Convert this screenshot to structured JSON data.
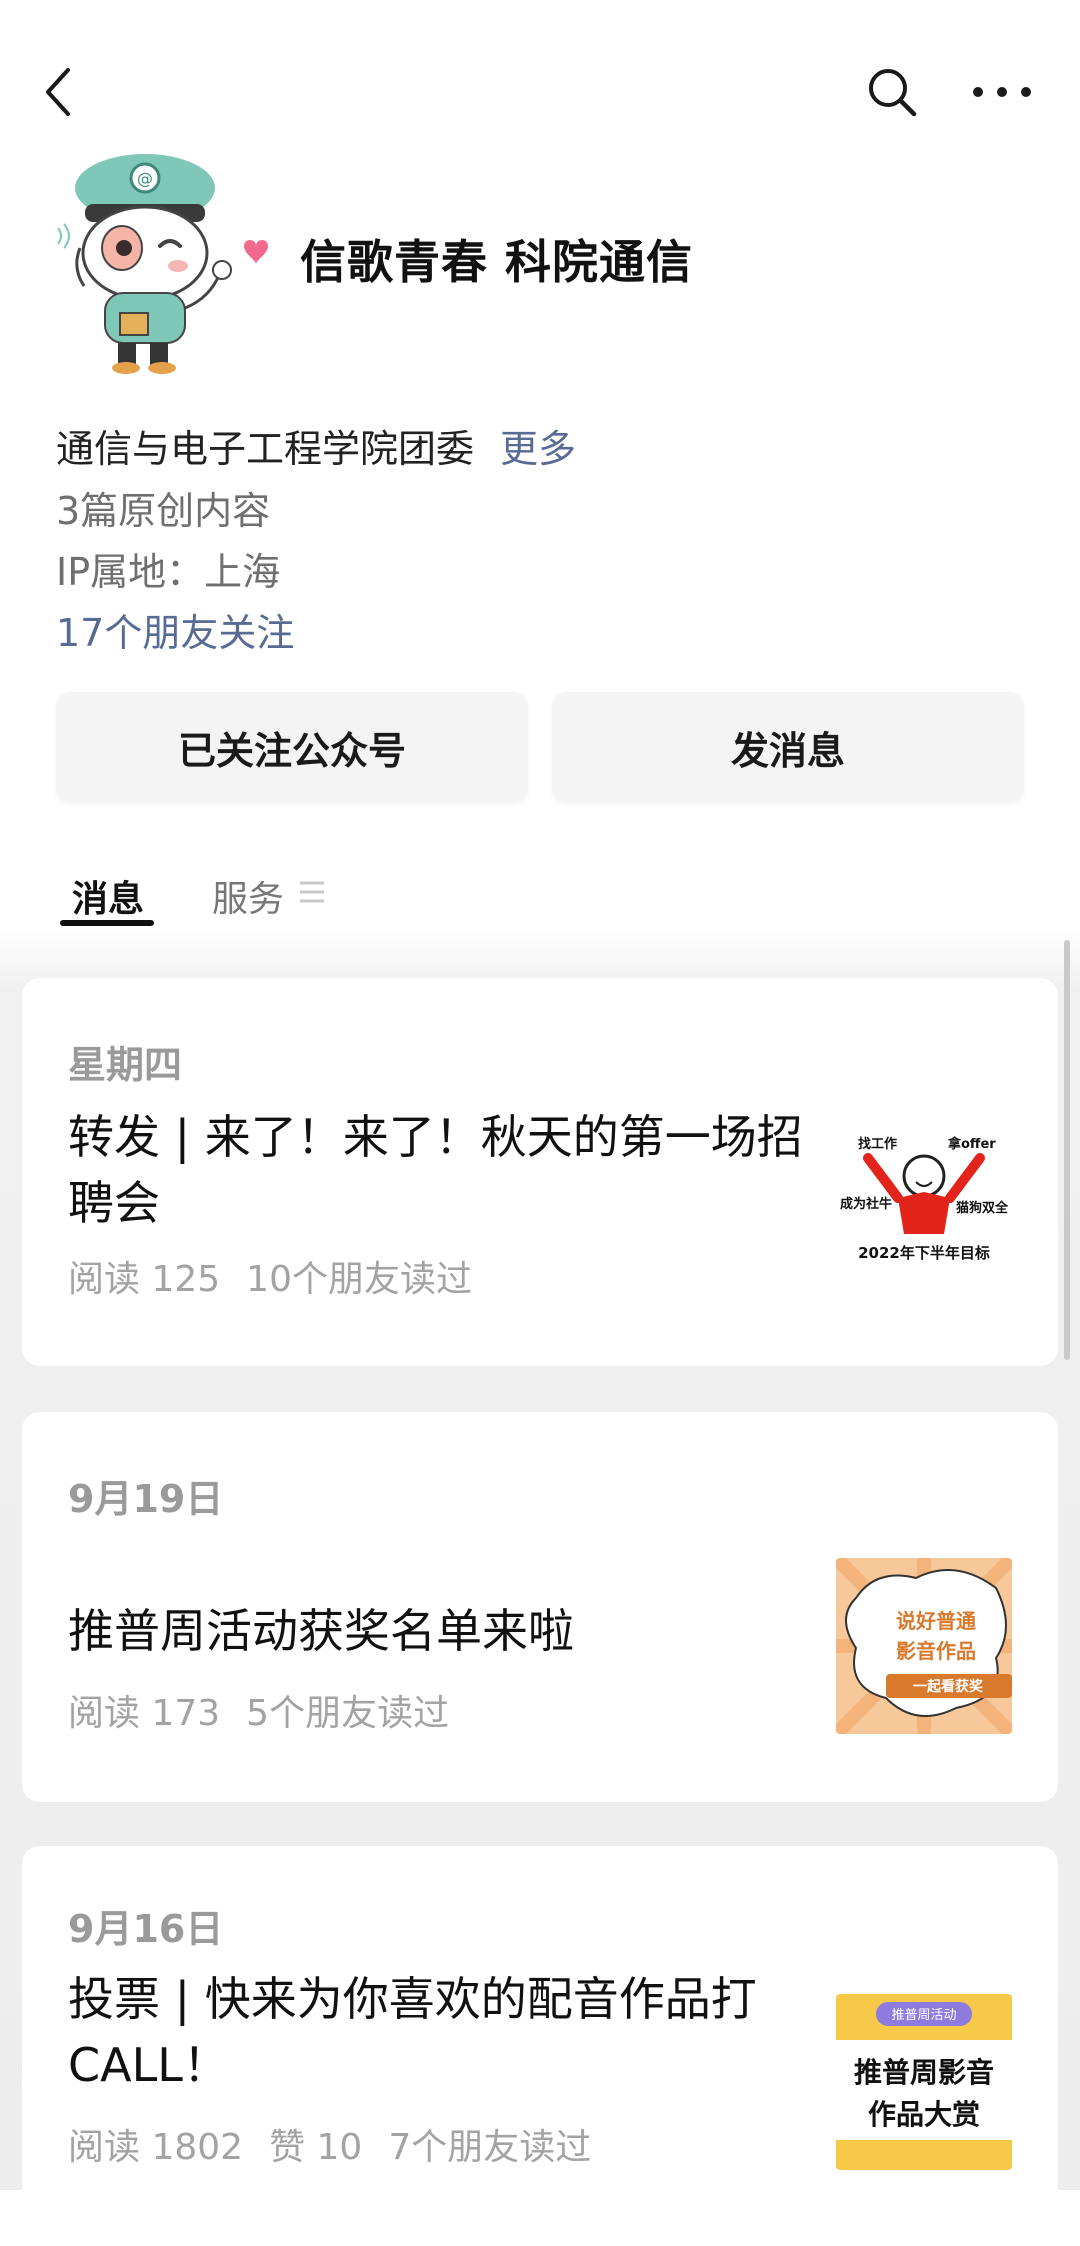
{
  "header": {
    "account_name": "信歌青春 科院通信"
  },
  "profile": {
    "description": "通信与电子工程学院团委",
    "more_link": "更多",
    "original_count": "3篇原创内容",
    "ip_location": "IP属地：上海",
    "friends_following": "17个朋友关注"
  },
  "actions": {
    "followed_label": "已关注公众号",
    "message_label": "发消息"
  },
  "tabs": [
    {
      "label": "消息",
      "selected": true
    },
    {
      "label": "服务",
      "selected": false
    }
  ],
  "articles": [
    {
      "date": "星期四",
      "title": "转发 | 来了！来了！秋天的第一场招聘会",
      "meta": [
        "阅读 125",
        "10个朋友读过"
      ],
      "thumb_text": [
        "找工作",
        "拿offer",
        "成为社牛",
        "猫狗双全",
        "2022年下半年目标"
      ]
    },
    {
      "date": "9月19日",
      "title": "推普周活动获奖名单来啦",
      "meta": [
        "阅读 173",
        "5个朋友读过"
      ],
      "thumb_text": [
        "说好普通",
        "影音作品",
        "一起看获奖"
      ]
    },
    {
      "date": "9月16日",
      "title": "投票 | 快来为你喜欢的配音作品打CALL！",
      "meta": [
        "阅读 1802",
        "赞 10",
        "7个朋友读过"
      ],
      "thumb_text": [
        "推普周活动",
        "推普周影音",
        "作品大赏"
      ]
    }
  ],
  "colors": {
    "link": "#576b95",
    "text_primary": "#111111",
    "text_secondary": "#6f6f6f",
    "feed_background": "#ededed"
  }
}
